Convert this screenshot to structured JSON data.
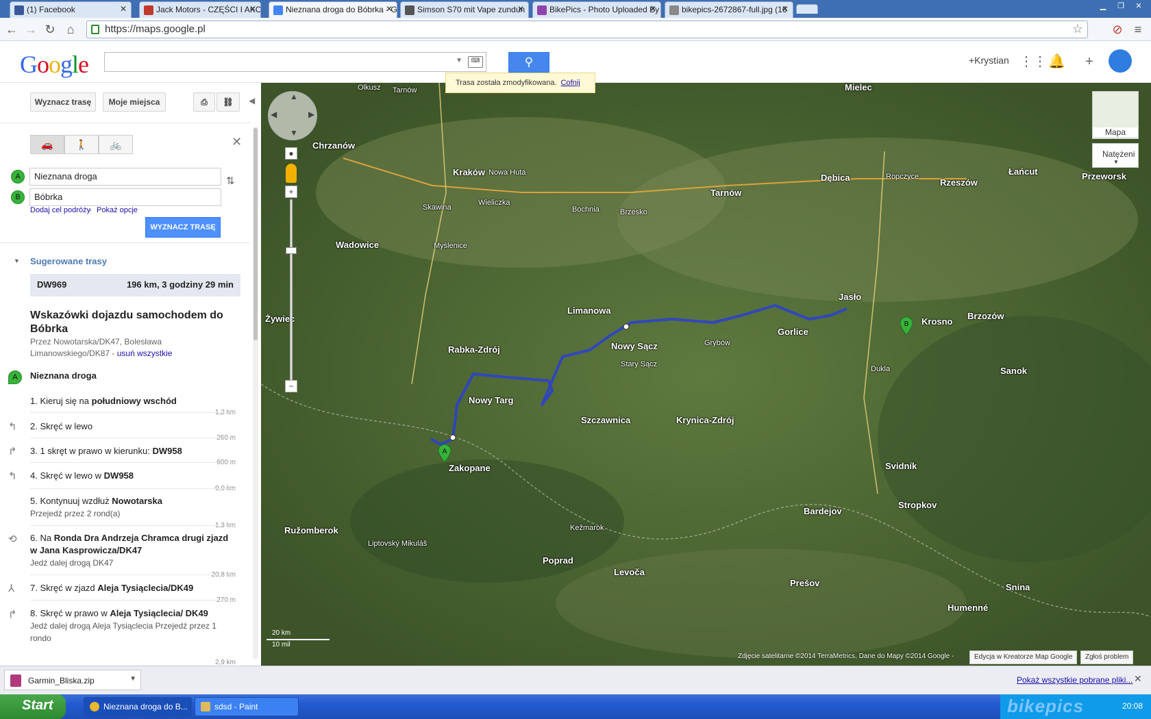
{
  "browser": {
    "tabs": [
      {
        "title": "(1) Facebook",
        "color": "#3b5998"
      },
      {
        "title": "Jack Motors - CZĘŚCI I AKCE",
        "color": "#c0392b"
      },
      {
        "title": "Nieznana droga do Bóbrka - Go",
        "color": "#4285f4"
      },
      {
        "title": "Simson S70 mit Vape zundun",
        "color": "#555555"
      },
      {
        "title": "BikePics - Photo Uploaded By",
        "color": "#8e44ad"
      },
      {
        "title": "bikepics-2672867-full.jpg (16",
        "color": "#888888"
      }
    ],
    "url": "https://maps.google.pl"
  },
  "header": {
    "logo": "Google",
    "search_value": "",
    "user_name": "+Krystian"
  },
  "toast": {
    "message": "Trasa została zmodyfikowana.",
    "undo": "Cofnij"
  },
  "sidebar": {
    "directions_button": "Wyznacz trasę",
    "my_places_button": "Moje miejsca",
    "waypoint_a": "Nieznana droga",
    "waypoint_b": "Bóbrka",
    "add_destination": "Dodaj cel podróży",
    "show_options": "Pokaż opcje",
    "separator": " - ",
    "route_button": "WYZNACZ TRASĘ",
    "suggested_routes": "Sugerowane trasy",
    "route_name": "DW969",
    "route_summary": "196 km, 3 godziny 29 min",
    "directions_title": "Wskazówki dojazdu samochodem do Bóbrka",
    "via_text": "Przez Nowotarska/DK47, Bolesława Limanowskiego/DK87 -",
    "remove_all": "usuń wszystkie",
    "start_name": "Nieznana droga",
    "steps": [
      {
        "num": "1.",
        "text": "Kieruj się na ",
        "bold": "południowy wschód",
        "sub": "",
        "dist": "1,2 km"
      },
      {
        "num": "2.",
        "text": "Skręć w lewo",
        "bold": "",
        "sub": "",
        "dist": "260 m"
      },
      {
        "num": "3.",
        "text": "1 skręt w prawo w kierunku: ",
        "bold": "DW958",
        "sub": "",
        "dist": "600 m"
      },
      {
        "num": "4.",
        "text": "Skręć w lewo w ",
        "bold": "DW958",
        "sub": "",
        "dist": "9,0 km"
      },
      {
        "num": "5.",
        "text": "Kontynuuj wzdłuż ",
        "bold": "Nowotarska",
        "sub": "Przejedź przez 2 rond(a)",
        "dist": "1,3 km"
      },
      {
        "num": "6.",
        "text": "Na ",
        "bold": "Ronda Dra Andrzeja Chramca drugi zjazd w Jana Kasprowicza/DK47",
        "sub": "Jedź dalej drogą DK47",
        "dist": "20,8 km"
      },
      {
        "num": "7.",
        "text": "Skręć w zjazd ",
        "bold": "Aleja Tysiąclecia/DK49",
        "sub": "",
        "dist": "270 m"
      },
      {
        "num": "8.",
        "text": "Skręć w prawo w ",
        "bold": "Aleja Tysiąclecia/ DK49",
        "sub": "Jedź dalej drogą Aleja Tysiąclecia Przejedź przez 1 rondo",
        "dist": "2,9 km"
      }
    ]
  },
  "map": {
    "layer_label": "Mapa",
    "traffic_label": "Natężeni",
    "scale_km": "20 km",
    "scale_mi": "10 mil",
    "attribution": "Zdjęcie satelitarne ©2014 TerraMetrics, Dane do Mapy ©2014 Google -",
    "edit_button": "Edycja w Kreatorze Map Google",
    "report_button": "Zgłoś problem",
    "labels": [
      {
        "t": "Olkusz"
      },
      {
        "t": "Tarnów"
      },
      {
        "t": "Mielec"
      },
      {
        "t": "Kraków"
      },
      {
        "t": "Nowa Huta"
      },
      {
        "t": "Wieliczka"
      },
      {
        "t": "Bochnia"
      },
      {
        "t": "Brzesko"
      },
      {
        "t": "Tarnów"
      },
      {
        "t": "Dębica"
      },
      {
        "t": "Ropczyce"
      },
      {
        "t": "Rzeszów"
      },
      {
        "t": "Łańcut"
      },
      {
        "t": "Przeworsk"
      },
      {
        "t": "Chrzanów"
      },
      {
        "t": "Wadowice"
      },
      {
        "t": "Skawina"
      },
      {
        "t": "Myślenice"
      },
      {
        "t": "Limanowa"
      },
      {
        "t": "Gorlice"
      },
      {
        "t": "Jasło"
      },
      {
        "t": "Krosno"
      },
      {
        "t": "Brzozów"
      },
      {
        "t": "Sanok"
      },
      {
        "t": "Nowy Sącz"
      },
      {
        "t": "Stary Sącz"
      },
      {
        "t": "Grybów"
      },
      {
        "t": "Rabka-Zdrój"
      },
      {
        "t": "Nowy Targ"
      },
      {
        "t": "Zakopane"
      },
      {
        "t": "Szczawnica"
      },
      {
        "t": "Krynica-Zdrój"
      },
      {
        "t": "Bardejov"
      },
      {
        "t": "Svidník"
      },
      {
        "t": "Stropkov"
      },
      {
        "t": "Poprad"
      },
      {
        "t": "Prešov"
      },
      {
        "t": "Humenné"
      },
      {
        "t": "Snina"
      },
      {
        "t": "Żywiec"
      },
      {
        "t": "Ružomberok"
      },
      {
        "t": "Liptovský Mikuláš"
      },
      {
        "t": "Kežmarok"
      },
      {
        "t": "Levoča"
      },
      {
        "t": "Dukla"
      }
    ]
  },
  "downloads": {
    "file": "Garmin_Bliska.zip",
    "show_all": "Pokaż wszystkie pobrane pliki..."
  },
  "taskbar": {
    "start": "Start",
    "items": [
      "Nieznana droga do B...",
      "sdsd - Paint"
    ],
    "brand": "bikepics",
    "clock": "20:08"
  }
}
